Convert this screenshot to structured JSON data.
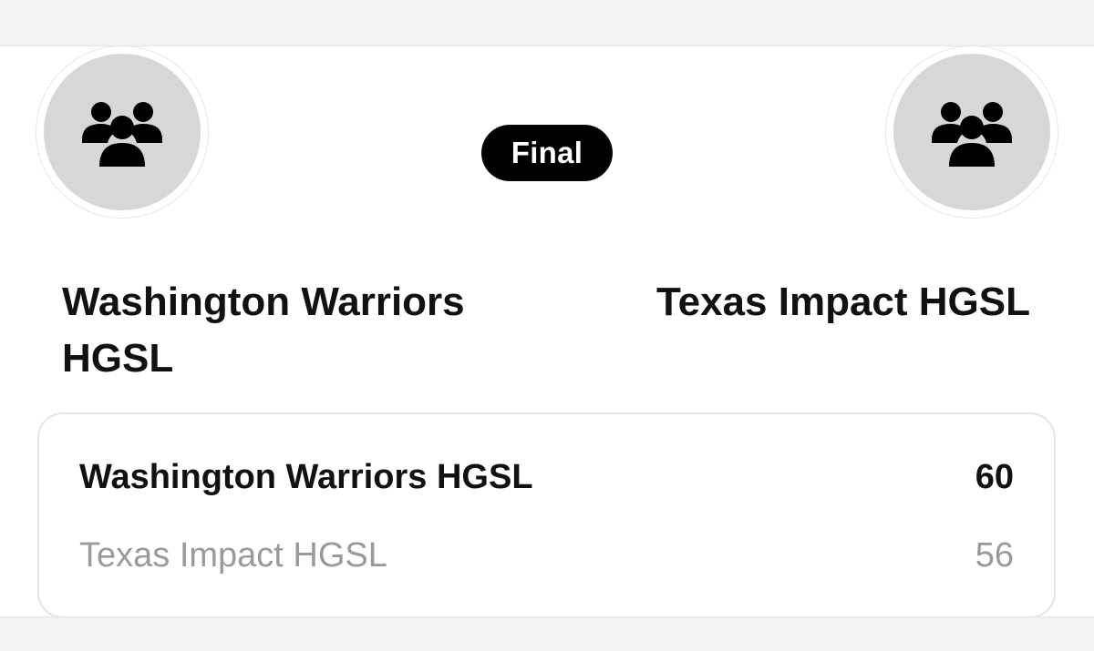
{
  "game": {
    "status": "Final",
    "home_team": {
      "name": "Washington Warriors HGSL",
      "icon": "team-group-icon"
    },
    "away_team": {
      "name": "Texas Impact HGSL",
      "icon": "team-group-icon"
    }
  },
  "scoreboard": {
    "rows": [
      {
        "team": "Washington Warriors HGSL",
        "score": "60"
      },
      {
        "team": "Texas Impact HGSL",
        "score": "56"
      }
    ]
  },
  "colors": {
    "pill_background": "#000000",
    "pill_text": "#ffffff",
    "winner_text": "#111111",
    "loser_text": "#9a9a9a",
    "avatar_fill": "#d7d7d7"
  }
}
